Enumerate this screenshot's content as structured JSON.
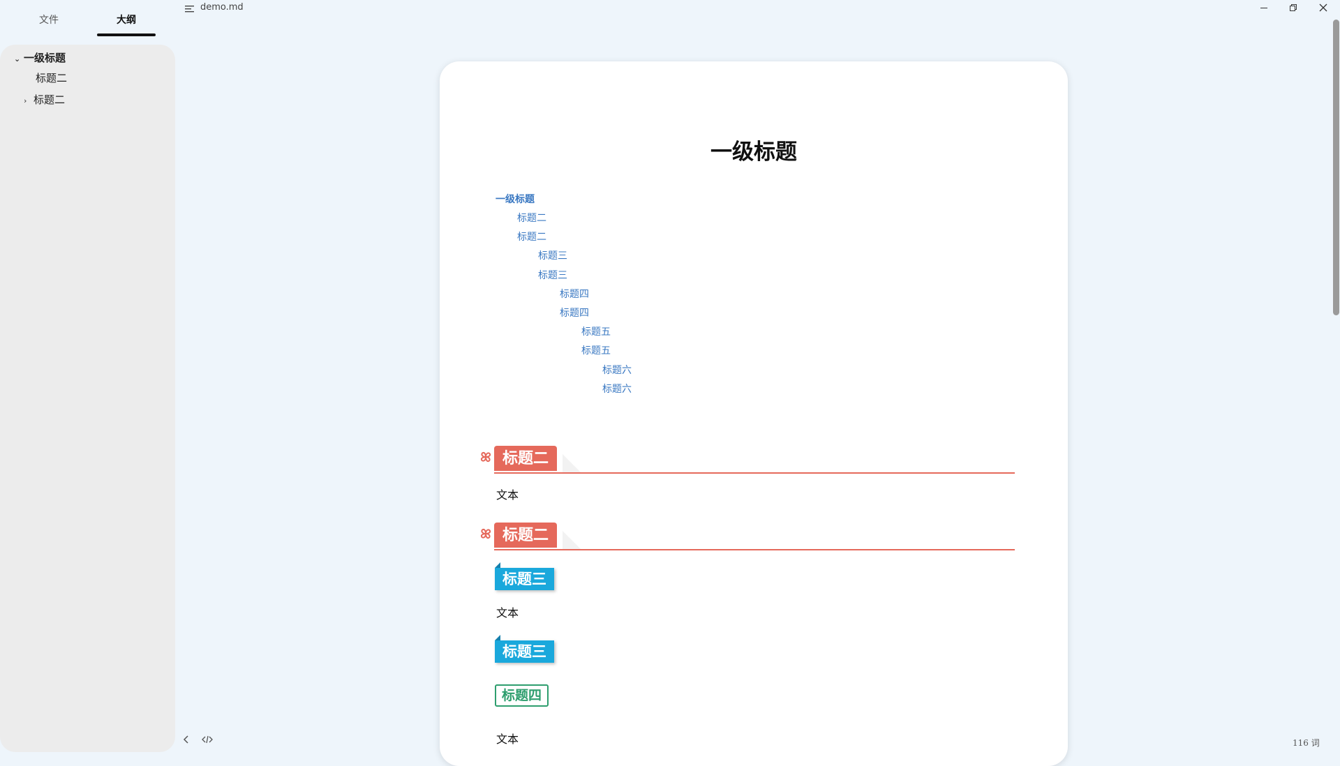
{
  "window": {
    "filename": "demo.md",
    "minimize_icon": "minimize-icon",
    "maximize_icon": "restore-icon",
    "close_icon": "close-icon"
  },
  "sidebar": {
    "tabs": [
      {
        "label": "文件",
        "active": false
      },
      {
        "label": "大纲",
        "active": true
      }
    ],
    "outline": [
      {
        "label": "一级标题",
        "expanded": true
      },
      {
        "label": "标题二"
      },
      {
        "label": "标题二",
        "collapsed": true
      }
    ]
  },
  "document": {
    "title": "一级标题",
    "toc": [
      "一级标题",
      "标题二",
      "标题二",
      "标题三",
      "标题三",
      "标题四",
      "标题四",
      "标题五",
      "标题五",
      "标题六",
      "标题六"
    ],
    "sections": {
      "h2_a": "标题二",
      "text_a": "文本",
      "h2_b": "标题二",
      "h3_a": "标题三",
      "text_b": "文本",
      "h3_b": "标题三",
      "h4_a": "标题四",
      "text_c": "文本"
    },
    "colors": {
      "h2": "#e5695b",
      "h3": "#1aa8dc",
      "h4": "#2e9e6e",
      "link": "#3a78c2"
    }
  },
  "statusbar": {
    "word_count": "116 词"
  }
}
